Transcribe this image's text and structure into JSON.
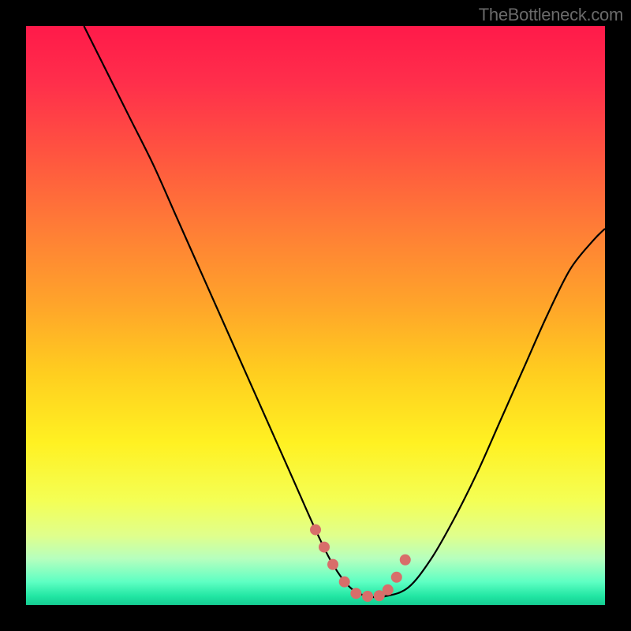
{
  "watermark": "TheBottleneck.com",
  "colors": {
    "background": "#000000",
    "gradient_stops": [
      {
        "offset": 0.0,
        "color": "#ff1a4a"
      },
      {
        "offset": 0.1,
        "color": "#ff2f4b"
      },
      {
        "offset": 0.22,
        "color": "#ff5440"
      },
      {
        "offset": 0.35,
        "color": "#ff7d36"
      },
      {
        "offset": 0.48,
        "color": "#ffa42a"
      },
      {
        "offset": 0.6,
        "color": "#ffce1f"
      },
      {
        "offset": 0.72,
        "color": "#fff122"
      },
      {
        "offset": 0.82,
        "color": "#f4ff55"
      },
      {
        "offset": 0.88,
        "color": "#e0ff8c"
      },
      {
        "offset": 0.92,
        "color": "#b6ffbe"
      },
      {
        "offset": 0.96,
        "color": "#5effc3"
      },
      {
        "offset": 0.985,
        "color": "#21e6a3"
      },
      {
        "offset": 1.0,
        "color": "#15cc92"
      }
    ],
    "curve": "#000000",
    "marker_fill": "#d86e6a",
    "marker_outline": "#d86e6a"
  },
  "chart_data": {
    "type": "line",
    "title": "",
    "xlabel": "",
    "ylabel": "",
    "xlim": [
      0,
      100
    ],
    "ylim": [
      0,
      100
    ],
    "curve": {
      "x": [
        10,
        14,
        18,
        22,
        26,
        30,
        34,
        38,
        42,
        46,
        50,
        53,
        56,
        59,
        62,
        66,
        70,
        74,
        78,
        82,
        86,
        90,
        94,
        98,
        100
      ],
      "y": [
        100,
        92,
        84,
        76,
        67,
        58,
        49,
        40,
        31,
        22,
        13,
        7,
        3,
        1.5,
        1.5,
        3,
        8,
        15,
        23,
        32,
        41,
        50,
        58,
        63,
        65
      ]
    },
    "highlight_band": {
      "description": "thick marker segment at curve trough",
      "x": [
        50,
        51.5,
        53,
        55,
        57,
        59,
        61,
        62.5,
        64,
        65.5
      ],
      "y": [
        13,
        10,
        7,
        4,
        2,
        1.5,
        1.6,
        2.6,
        4.8,
        7.8
      ],
      "radius": 7
    }
  }
}
